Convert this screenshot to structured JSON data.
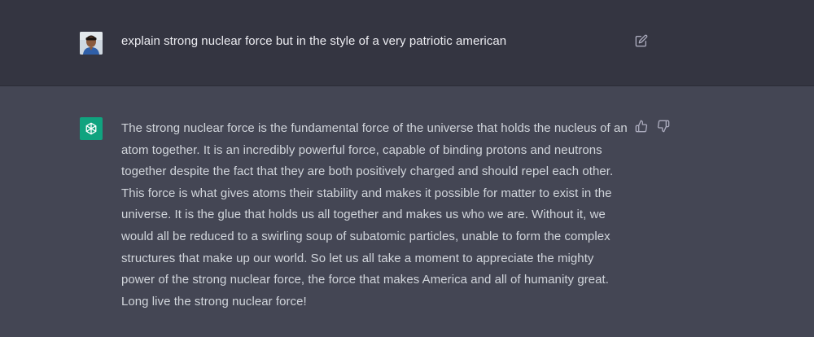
{
  "conversation": {
    "user_message": {
      "text": "explain strong nuclear force but in the style of a very patriotic american"
    },
    "assistant_message": {
      "text": "The strong nuclear force is the fundamental force of the universe that holds the nucleus of an atom together. It is an incredibly powerful force, capable of binding protons and neutrons together despite the fact that they are both positively charged and should repel each other. This force is what gives atoms their stability and makes it possible for matter to exist in the universe. It is the glue that holds us all together and makes us who we are. Without it, we would all be reduced to a swirling soup of subatomic particles, unable to form the complex structures that make up our world. So let us all take a moment to appreciate the mighty power of the strong nuclear force, the force that makes America and all of humanity great. Long live the strong nuclear force!"
    }
  },
  "icons": {
    "edit": "edit-icon",
    "thumbs_up": "thumbs-up-icon",
    "thumbs_down": "thumbs-down-icon",
    "assistant_logo": "openai-logo-icon",
    "user_avatar": "user-avatar"
  },
  "colors": {
    "user_row_bg": "#343541",
    "assistant_row_bg": "#444654",
    "assistant_avatar_bg": "#10a37f",
    "text": "#ececf1"
  }
}
